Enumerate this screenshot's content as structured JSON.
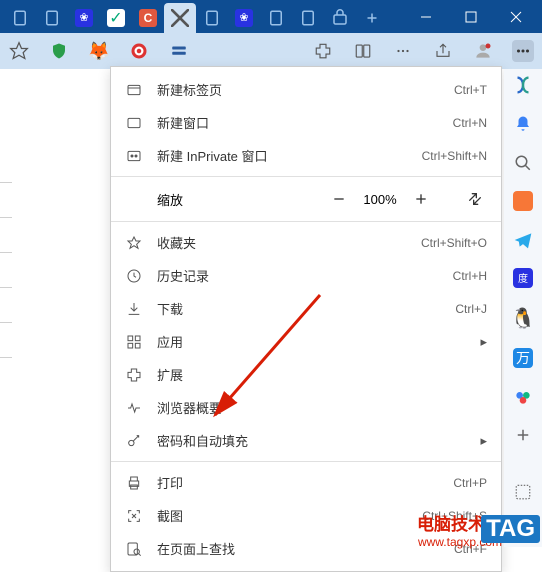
{
  "titlebar": {
    "tabs": [
      {
        "icon": "file",
        "color": "#9ac1e8"
      },
      {
        "icon": "file",
        "color": "#9ac1e8"
      },
      {
        "icon": "baidu",
        "color": "#fff"
      },
      {
        "icon": "check",
        "color": "#fff"
      },
      {
        "icon": "c-letter",
        "color": "#fff"
      },
      {
        "icon": "active-blank",
        "color": "#333"
      },
      {
        "icon": "file",
        "color": "#9ac1e8"
      },
      {
        "icon": "baidu",
        "color": "#fff"
      },
      {
        "icon": "file",
        "color": "#9ac1e8"
      },
      {
        "icon": "file",
        "color": "#9ac1e8"
      },
      {
        "icon": "bag",
        "color": "#9ac1e8"
      },
      {
        "icon": "plus",
        "color": "#9ac1e8"
      }
    ]
  },
  "toolbar": {
    "icons": [
      "star-outline",
      "shield",
      "fox",
      "target",
      "cards",
      "puzzle",
      "panels",
      "dots3",
      "share",
      "avatar",
      "more"
    ]
  },
  "menu": {
    "new_tab": {
      "label": "新建标签页",
      "shortcut": "Ctrl+T"
    },
    "new_window": {
      "label": "新建窗口",
      "shortcut": "Ctrl+N"
    },
    "new_inprivate": {
      "label": "新建 InPrivate 窗口",
      "shortcut": "Ctrl+Shift+N"
    },
    "zoom": {
      "label": "缩放",
      "value": "100%"
    },
    "favorites": {
      "label": "收藏夹",
      "shortcut": "Ctrl+Shift+O"
    },
    "history": {
      "label": "历史记录",
      "shortcut": "Ctrl+H"
    },
    "downloads": {
      "label": "下载",
      "shortcut": "Ctrl+J"
    },
    "apps": {
      "label": "应用"
    },
    "extensions": {
      "label": "扩展"
    },
    "essentials": {
      "label": "浏览器概要"
    },
    "passwords": {
      "label": "密码和自动填充"
    },
    "print": {
      "label": "打印",
      "shortcut": "Ctrl+P"
    },
    "screenshot": {
      "label": "截图",
      "shortcut": "Ctrl+Shift+S"
    },
    "find": {
      "label": "在页面上查找",
      "shortcut": "Ctrl+F"
    }
  },
  "watermark": {
    "line1": "电脑技术网",
    "line2": "www.tagxp.com",
    "tag": "TAG"
  }
}
